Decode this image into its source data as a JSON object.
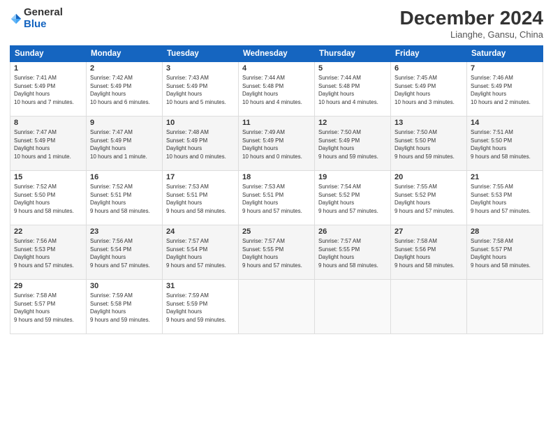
{
  "logo": {
    "general": "General",
    "blue": "Blue"
  },
  "header": {
    "month_year": "December 2024",
    "location": "Lianghe, Gansu, China"
  },
  "weekdays": [
    "Sunday",
    "Monday",
    "Tuesday",
    "Wednesday",
    "Thursday",
    "Friday",
    "Saturday"
  ],
  "weeks": [
    [
      {
        "day": "1",
        "sunrise": "7:41 AM",
        "sunset": "5:49 PM",
        "daylight": "10 hours and 7 minutes."
      },
      {
        "day": "2",
        "sunrise": "7:42 AM",
        "sunset": "5:49 PM",
        "daylight": "10 hours and 6 minutes."
      },
      {
        "day": "3",
        "sunrise": "7:43 AM",
        "sunset": "5:49 PM",
        "daylight": "10 hours and 5 minutes."
      },
      {
        "day": "4",
        "sunrise": "7:44 AM",
        "sunset": "5:48 PM",
        "daylight": "10 hours and 4 minutes."
      },
      {
        "day": "5",
        "sunrise": "7:44 AM",
        "sunset": "5:48 PM",
        "daylight": "10 hours and 4 minutes."
      },
      {
        "day": "6",
        "sunrise": "7:45 AM",
        "sunset": "5:49 PM",
        "daylight": "10 hours and 3 minutes."
      },
      {
        "day": "7",
        "sunrise": "7:46 AM",
        "sunset": "5:49 PM",
        "daylight": "10 hours and 2 minutes."
      }
    ],
    [
      {
        "day": "8",
        "sunrise": "7:47 AM",
        "sunset": "5:49 PM",
        "daylight": "10 hours and 1 minute."
      },
      {
        "day": "9",
        "sunrise": "7:47 AM",
        "sunset": "5:49 PM",
        "daylight": "10 hours and 1 minute."
      },
      {
        "day": "10",
        "sunrise": "7:48 AM",
        "sunset": "5:49 PM",
        "daylight": "10 hours and 0 minutes."
      },
      {
        "day": "11",
        "sunrise": "7:49 AM",
        "sunset": "5:49 PM",
        "daylight": "10 hours and 0 minutes."
      },
      {
        "day": "12",
        "sunrise": "7:50 AM",
        "sunset": "5:49 PM",
        "daylight": "9 hours and 59 minutes."
      },
      {
        "day": "13",
        "sunrise": "7:50 AM",
        "sunset": "5:50 PM",
        "daylight": "9 hours and 59 minutes."
      },
      {
        "day": "14",
        "sunrise": "7:51 AM",
        "sunset": "5:50 PM",
        "daylight": "9 hours and 58 minutes."
      }
    ],
    [
      {
        "day": "15",
        "sunrise": "7:52 AM",
        "sunset": "5:50 PM",
        "daylight": "9 hours and 58 minutes."
      },
      {
        "day": "16",
        "sunrise": "7:52 AM",
        "sunset": "5:51 PM",
        "daylight": "9 hours and 58 minutes."
      },
      {
        "day": "17",
        "sunrise": "7:53 AM",
        "sunset": "5:51 PM",
        "daylight": "9 hours and 58 minutes."
      },
      {
        "day": "18",
        "sunrise": "7:53 AM",
        "sunset": "5:51 PM",
        "daylight": "9 hours and 57 minutes."
      },
      {
        "day": "19",
        "sunrise": "7:54 AM",
        "sunset": "5:52 PM",
        "daylight": "9 hours and 57 minutes."
      },
      {
        "day": "20",
        "sunrise": "7:55 AM",
        "sunset": "5:52 PM",
        "daylight": "9 hours and 57 minutes."
      },
      {
        "day": "21",
        "sunrise": "7:55 AM",
        "sunset": "5:53 PM",
        "daylight": "9 hours and 57 minutes."
      }
    ],
    [
      {
        "day": "22",
        "sunrise": "7:56 AM",
        "sunset": "5:53 PM",
        "daylight": "9 hours and 57 minutes."
      },
      {
        "day": "23",
        "sunrise": "7:56 AM",
        "sunset": "5:54 PM",
        "daylight": "9 hours and 57 minutes."
      },
      {
        "day": "24",
        "sunrise": "7:57 AM",
        "sunset": "5:54 PM",
        "daylight": "9 hours and 57 minutes."
      },
      {
        "day": "25",
        "sunrise": "7:57 AM",
        "sunset": "5:55 PM",
        "daylight": "9 hours and 57 minutes."
      },
      {
        "day": "26",
        "sunrise": "7:57 AM",
        "sunset": "5:55 PM",
        "daylight": "9 hours and 58 minutes."
      },
      {
        "day": "27",
        "sunrise": "7:58 AM",
        "sunset": "5:56 PM",
        "daylight": "9 hours and 58 minutes."
      },
      {
        "day": "28",
        "sunrise": "7:58 AM",
        "sunset": "5:57 PM",
        "daylight": "9 hours and 58 minutes."
      }
    ],
    [
      {
        "day": "29",
        "sunrise": "7:58 AM",
        "sunset": "5:57 PM",
        "daylight": "9 hours and 59 minutes."
      },
      {
        "day": "30",
        "sunrise": "7:59 AM",
        "sunset": "5:58 PM",
        "daylight": "9 hours and 59 minutes."
      },
      {
        "day": "31",
        "sunrise": "7:59 AM",
        "sunset": "5:59 PM",
        "daylight": "9 hours and 59 minutes."
      },
      null,
      null,
      null,
      null
    ]
  ]
}
